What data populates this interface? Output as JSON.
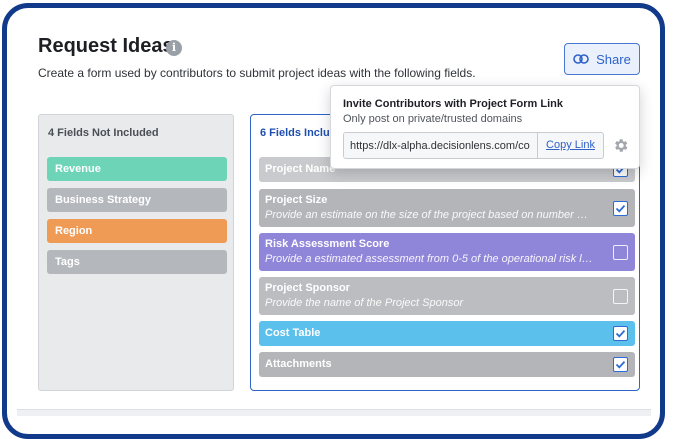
{
  "header": {
    "title": "Request Ideas",
    "info_icon": "info-icon",
    "subtitle": "Create a form used by contributors to submit project ideas with the following fields.",
    "share_label": "Share",
    "share_icon": "link-icon"
  },
  "left_panel": {
    "heading": "4 Fields Not Included",
    "items": [
      {
        "label": "Revenue",
        "color": "#6dd4b8"
      },
      {
        "label": "Business Strategy",
        "color": "#b4b7bc"
      },
      {
        "label": "Region",
        "color": "#f09b55"
      },
      {
        "label": "Tags",
        "color": "#b4b7bc"
      }
    ]
  },
  "right_panel": {
    "heading": "6 Fields Included",
    "fields": [
      {
        "title": "Project Name",
        "description": "",
        "checked": true,
        "color": "#c9cacd"
      },
      {
        "title": "Project Size",
        "description": "Provide an estimate on the size of the project based on number of i...",
        "checked": true,
        "color": "#b3b5b9"
      },
      {
        "title": "Risk Assessment Score",
        "description": "Provide a estimated assessment from 0-5 of the operational risk lev...",
        "checked": false,
        "color": "#8f85d9"
      },
      {
        "title": "Project Sponsor",
        "description": "Provide the name of the Project Sponsor",
        "checked": false,
        "color": "#bbbdc1"
      },
      {
        "title": "Cost Table",
        "description": "",
        "checked": true,
        "color": "#5cc0ec"
      },
      {
        "title": "Attachments",
        "description": "",
        "checked": true,
        "color": "#b3b5b9"
      }
    ]
  },
  "popover": {
    "title": "Invite Contributors with Project Form Link",
    "subtitle": "Only post on private/trusted domains",
    "link_value": "https://dlx-alpha.decisionlens.com/contribute",
    "copy_label": "Copy Link",
    "settings_icon": "gear-icon"
  },
  "colors": {
    "frame": "#123a8a",
    "accent": "#2e62c9",
    "checkbox": "#2d6cd8"
  }
}
